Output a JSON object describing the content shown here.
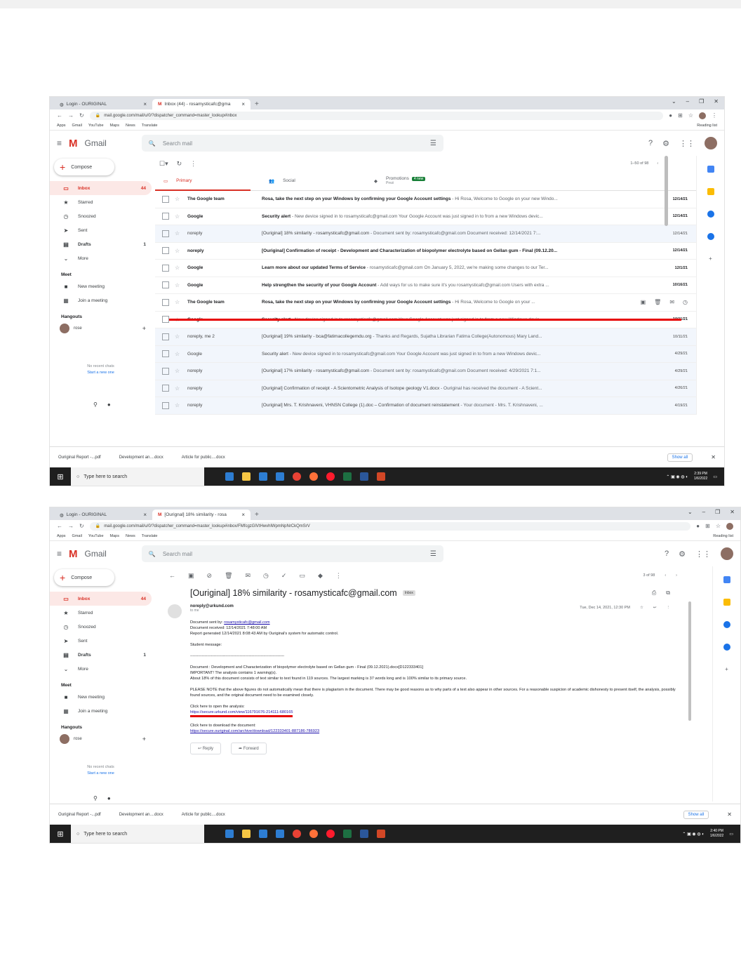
{
  "browser": {
    "tab1": "Login - OURIGINAL",
    "tab2_shot1": "Inbox (44) - rosamysticafc@gma",
    "tab2_shot2": "[Ourignal] 18% similarity - rosa",
    "url_shot1": "mail.google.com/mail/u/0/?dispatcher_command=master_lookup#inbox",
    "url_shot2": "mail.google.com/mail/u/0/?dispatcher_command=master_lookup#inbox/FMfcgzGlVtHwvhlWpmNpNrCkQmSrV",
    "bookmarks": [
      "Apps",
      "Gmail",
      "YouTube",
      "Maps",
      "News",
      "Translate"
    ],
    "reading_list": "Reading list"
  },
  "gmail": {
    "brand": "Gmail",
    "search_placeholder": "Search mail",
    "compose": "Compose",
    "nav": [
      {
        "label": "Inbox",
        "count": "44"
      },
      {
        "label": "Starred",
        "count": ""
      },
      {
        "label": "Snoozed",
        "count": ""
      },
      {
        "label": "Sent",
        "count": ""
      },
      {
        "label": "Drafts",
        "count": "1"
      },
      {
        "label": "More",
        "count": ""
      }
    ],
    "meet_heading": "Meet",
    "meet_items": [
      "New meeting",
      "Join a meeting"
    ],
    "hangouts_heading": "Hangouts",
    "hangouts_user": "rose",
    "no_chats": "No recent chats",
    "start_new": "Start a new one",
    "page_count_inbox": "1–50 of 98",
    "page_count_msg": "3 of 98"
  },
  "tabs": {
    "primary": "Primary",
    "social": "Social",
    "promotions": "Promotions",
    "promotions_badge": "4 new",
    "promotions_sub": "Prezi"
  },
  "inbox_rows": [
    {
      "sender": "The Google team",
      "subject": "Rosa, take the next step on your Windows by confirming your Google Account settings",
      "snippet": " - Hi Rosa, Welcome to Google on your new Windo...",
      "date": "12/14/21",
      "unread": true
    },
    {
      "sender": "Google",
      "subject": "Security alert",
      "snippet": " - New device signed in to rosamysticafc@gmail.com Your Google Account was just signed in to from a new Windows devic...",
      "date": "12/14/21",
      "unread": true
    },
    {
      "sender": "noreply",
      "subject": "[Ouriginal] 18% similarity - rosamysticafc@gmail.com",
      "snippet": " - Document sent by: rosamysticafc@gmail.com Document received: 12/14/2021 7:...",
      "date": "12/14/21",
      "unread": false
    },
    {
      "sender": "noreply",
      "subject": "[Ouriginal] Confirmation of receipt - Development and Characterization of biopolymer electrolyte based on Gellan gum - Final (09.12.20...",
      "snippet": "",
      "date": "12/14/21",
      "unread": true
    },
    {
      "sender": "Google",
      "subject": "Learn more about our updated Terms of Service",
      "snippet": " - rosamysticafc@gmail.com On January 5, 2022, we're making some changes to our Ter...",
      "date": "12/1/21",
      "unread": true
    },
    {
      "sender": "Google",
      "subject": "Help strengthen the security of your Google Account",
      "snippet": " - Add ways for us to make sure it's you rosamysticafc@gmail.com Users with extra ...",
      "date": "10/16/21",
      "unread": true
    },
    {
      "sender": "The Google team",
      "subject": "Rosa, take the next step on your Windows by confirming your Google Account settings",
      "snippet": " - Hi Rosa, Welcome to Google on your ...",
      "date": "",
      "unread": true
    },
    {
      "sender": "Google",
      "subject": "Security alert",
      "snippet": " - New device signed in to rosamysticafc@gmail.com Your Google Account was just signed in to from a new Windows devic...",
      "date": "10/11/21",
      "unread": true
    },
    {
      "sender": "noreply, me 2",
      "subject": "[Ouriginal] 19% similarity - bca@fatimacollegemdu.org",
      "snippet": " - Thanks and Regards, Sujatha Librarian Fatima College(Autonomous) Mary Land...",
      "date": "10/11/21",
      "unread": false
    },
    {
      "sender": "Google",
      "subject": "Security alert",
      "snippet": " - New device signed in to rosamysticafc@gmail.com Your Google Account was just signed in to from a new Windows devic...",
      "date": "4/29/21",
      "unread": false
    },
    {
      "sender": "noreply",
      "subject": "[Ouriginal] 17% similarity - rosamysticafc@gmail.com",
      "snippet": " - Document sent by: rosamysticafc@gmail.com Document received: 4/29/2021 7:1...",
      "date": "4/29/21",
      "unread": false
    },
    {
      "sender": "noreply",
      "subject": "[Ouriginal] Confirmation of receipt - A Scientometric Analysis of Isotope geology V1.docx",
      "snippet": " - Ouriginal has received the document - A Scient...",
      "date": "4/26/21",
      "unread": false
    },
    {
      "sender": "noreply",
      "subject": "[Ouriginal] Mrs. T. Krishnaveni, VHNSN College (1).doc – Confirmation of document reinstatement",
      "snippet": " - Your document - Mrs. T. Krishnaveni, ...",
      "date": "4/19/21",
      "unread": false
    }
  ],
  "downloads": [
    "Ouriginal Report -...pdf",
    "Development an....docx",
    "Article for public....docx"
  ],
  "show_all": "Show all",
  "taskbar": {
    "search": "Type here to search",
    "time1": "2:39 PM",
    "date1": "1/6/2022",
    "time2": "2:40 PM",
    "date2": "1/6/2022"
  },
  "message": {
    "subject": "[Ouriginal] 18% similarity - rosamysticafc@gmail.com",
    "label": "Inbox",
    "from": "noreply@urkund.com",
    "to": "to me",
    "date": "Tue, Dec 14, 2021, 12:30 PM",
    "line_sent_by_label": "Document sent by:",
    "line_sent_by_email": "rosamysticafc@gmail.com",
    "line_received": "Document received: 12/14/2021 7:48:00 AM",
    "line_report": "Report generated 12/14/2021 8:08:43 AM by Ouriginal's system for automatic control.",
    "student_msg": "Student message:",
    "divider": "------------------------------------------------------------------------",
    "doc_line": "Document : Development and Characterization of biopolymer electrolyte based on Gellan gum - Final (09.12.2021).docx[D122333401]",
    "important": "IMPORTANT! The analysis contains 1 warning(s).",
    "about": "About 18% of this document consists of text similar to text found in 119 sources. The largest marking is 37 words long and is 100% similar to its primary source.",
    "please_note": "PLEASE NOTE that the above figures do not automatically mean that there is plagiarism in the document. There may be good reasons as to why parts of a text also appear in other sources. For a reasonable suspicion of academic dishonesty to present itself, the analysis, possibly found sources, and the original document need to be examined closely.",
    "click_analysis": "Click here to open the analysis:",
    "analysis_link": "https://secure.urkund.com/view/116791676-214111-680165",
    "click_download": "Click here to download the document:",
    "download_link": "https://secure.ouriginal.com/archive/download/122333401-887186-786923",
    "reply": "Reply",
    "forward": "Forward"
  }
}
